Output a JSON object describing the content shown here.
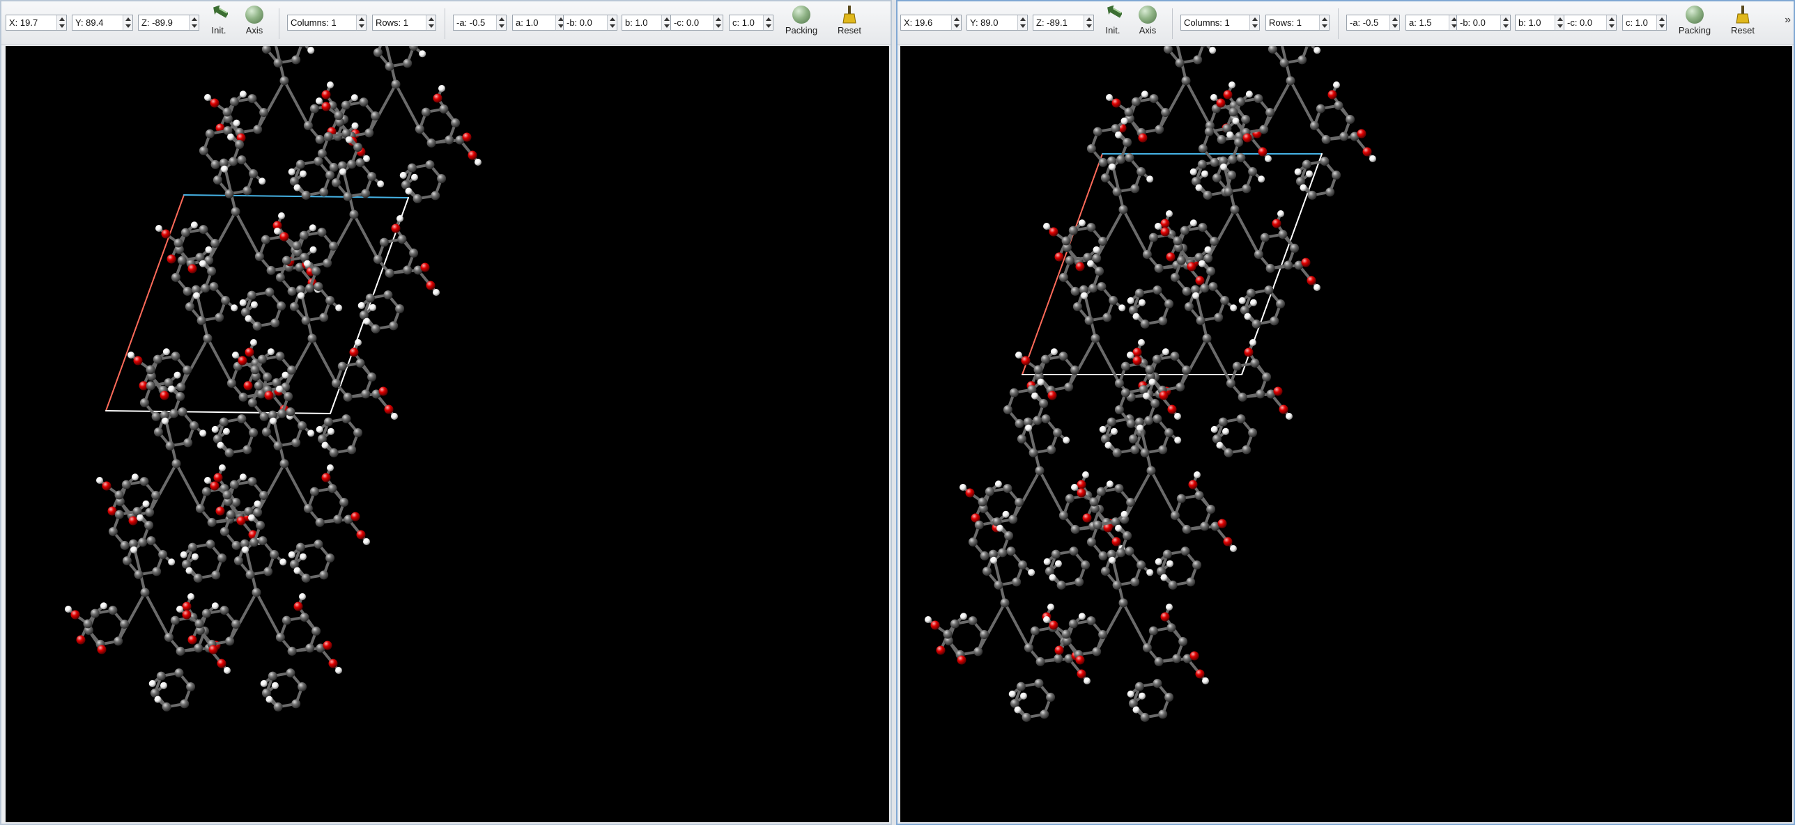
{
  "panels": [
    {
      "rotation": {
        "x": "X: 19.7",
        "y": "Y: 89.4",
        "z": "Z: -89.9"
      },
      "init_label": "Init.",
      "axis_label": "Axis",
      "columns": "Columns: 1",
      "rows": "Rows: 1",
      "planes": [
        "-a: -0.5",
        "a: 1.0",
        "-b: 0.0",
        "b: 1.0",
        "-c: 0.0",
        "c: 1.0"
      ],
      "packing_label": "Packing",
      "reset_label": "Reset"
    },
    {
      "rotation": {
        "x": "X: 19.6",
        "y": "Y: 89.0",
        "z": "Z: -89.1"
      },
      "init_label": "Init.",
      "axis_label": "Axis",
      "columns": "Columns: 1",
      "rows": "Rows: 1",
      "planes": [
        "-a: -0.5",
        "a: 1.5",
        "-b: 0.0",
        "b: 1.0",
        "-c: 0.0",
        "c: 1.0"
      ],
      "packing_label": "Packing",
      "reset_label": "Reset",
      "overflow": "»"
    }
  ],
  "colors": {
    "background": "#000000",
    "carbon": "#6e6e6e",
    "oxygen": "#e00000",
    "hydrogen": "#f2f2f2",
    "cell_a_edge": "#ff6b5a",
    "cell_b_edge": "#46b3e6",
    "cell_other_edge": "#ffffff"
  },
  "icons": {
    "init": "init-arrow-icon",
    "axis": "axis-sphere-icon",
    "packing": "packing-sphere-icon",
    "reset": "broom-icon",
    "overflow": "chevron-double-right-icon"
  }
}
